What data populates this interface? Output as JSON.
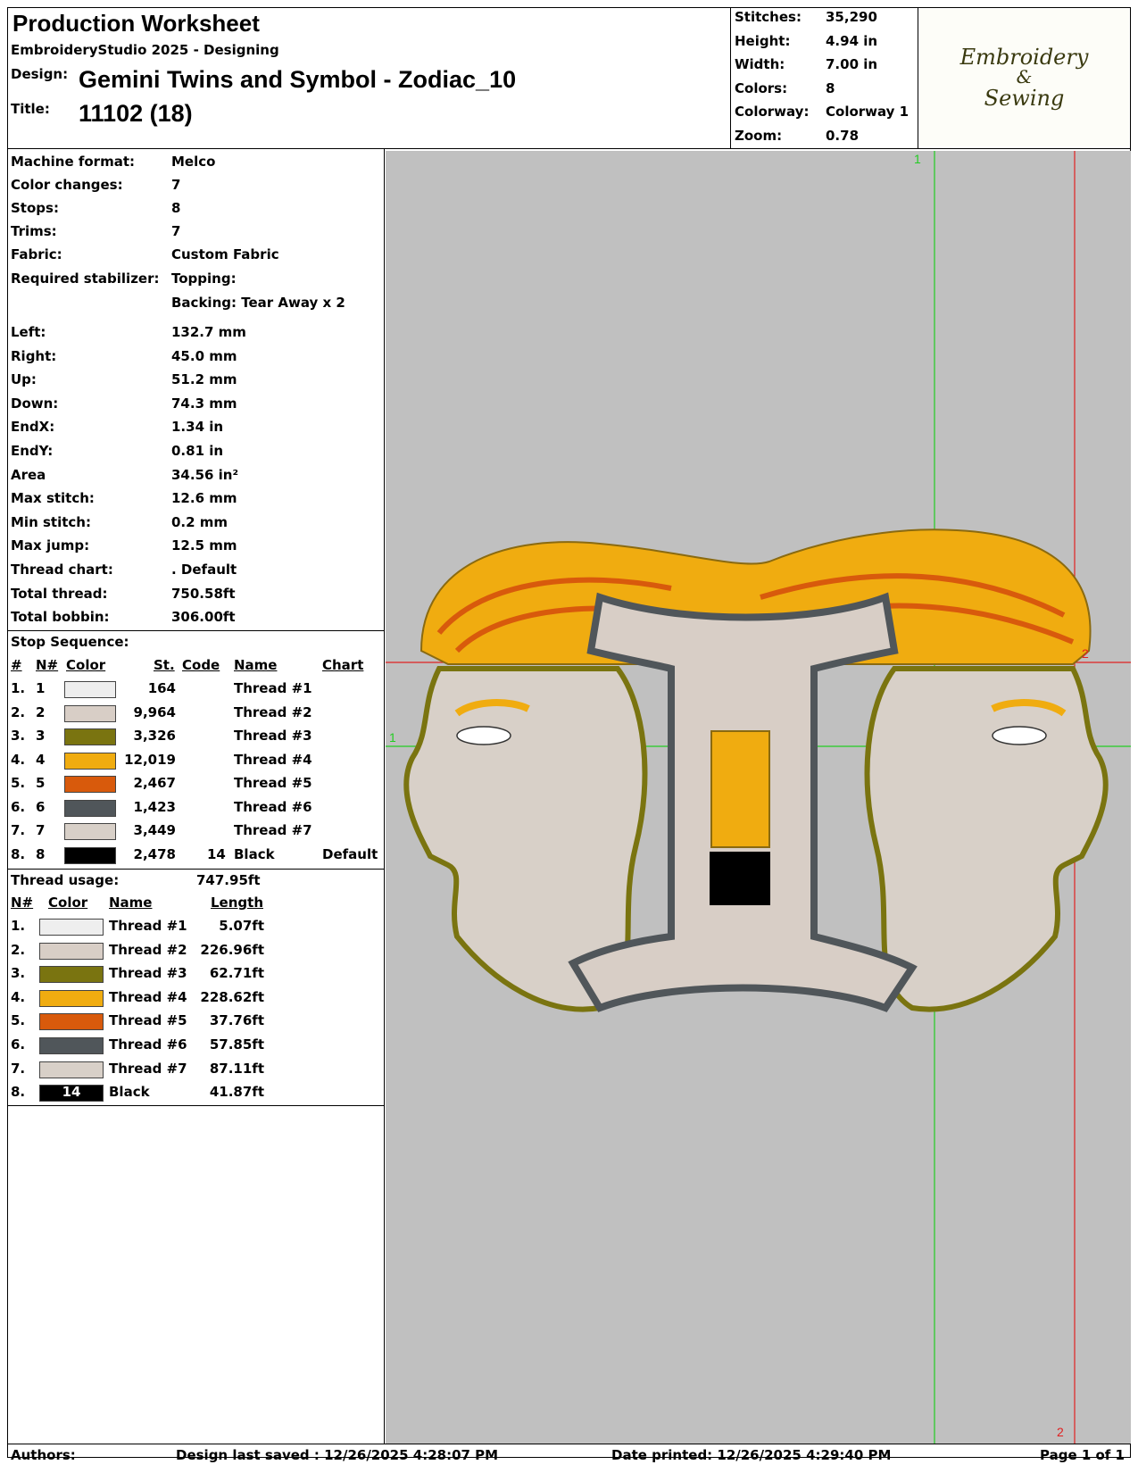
{
  "header": {
    "title": "Production Worksheet",
    "software": "EmbroideryStudio 2025 - Designing",
    "design_label": "Design:",
    "design_value": "Gemini Twins and Symbol - Zodiac_10",
    "title_label": "Title:",
    "title_value": "11102 (18)"
  },
  "stats": {
    "stitches_label": "Stitches:",
    "stitches": "35,290",
    "height_label": "Height:",
    "height": "4.94 in",
    "width_label": "Width:",
    "width": "7.00 in",
    "colors_label": "Colors:",
    "colors": "8",
    "colorway_label": "Colorway:",
    "colorway": "Colorway 1",
    "zoom_label": "Zoom:",
    "zoom": "0.78"
  },
  "logo": {
    "line1": "Embroidery",
    "line2": "&",
    "line3": "Sewing"
  },
  "details": [
    {
      "label": "Machine format:",
      "value": "Melco"
    },
    {
      "label": "Color changes:",
      "value": "7"
    },
    {
      "label": "Stops:",
      "value": "8"
    },
    {
      "label": "Trims:",
      "value": "7"
    },
    {
      "label": "Fabric:",
      "value": "Custom Fabric"
    },
    {
      "label": "Required stabilizer:",
      "value": "Topping:"
    },
    {
      "label": "",
      "value": "Backing: Tear Away x 2"
    }
  ],
  "measures": [
    {
      "label": "Left:",
      "value": "132.7 mm"
    },
    {
      "label": "Right:",
      "value": "45.0 mm"
    },
    {
      "label": "Up:",
      "value": "51.2 mm"
    },
    {
      "label": "Down:",
      "value": "74.3 mm"
    },
    {
      "label": "EndX:",
      "value": "1.34 in"
    },
    {
      "label": "EndY:",
      "value": "0.81 in"
    },
    {
      "label": "Area",
      "value": " 34.56 in²"
    },
    {
      "label": "Max stitch:",
      "value": "12.6 mm"
    },
    {
      "label": "Min stitch:",
      "value": "0.2 mm"
    },
    {
      "label": "Max jump:",
      "value": "12.5 mm"
    },
    {
      "label": "Thread chart:",
      "value": ". Default"
    },
    {
      "label": "Total thread:",
      "value": "750.58ft"
    },
    {
      "label": "Total bobbin:",
      "value": "306.00ft"
    }
  ],
  "stop_sequence": {
    "title": "Stop Sequence:",
    "headers": {
      "num": "#",
      "n": "N#",
      "color": "Color",
      "st": "St.",
      "code": "Code",
      "name": "Name",
      "chart": "Chart"
    },
    "rows": [
      {
        "num": "1.",
        "n": "1",
        "color": "#eeeeee",
        "st": "164",
        "code": "",
        "name": "Thread #1",
        "chart": ""
      },
      {
        "num": "2.",
        "n": "2",
        "color": "#d8cec6",
        "st": "9,964",
        "code": "",
        "name": "Thread #2",
        "chart": ""
      },
      {
        "num": "3.",
        "n": "3",
        "color": "#7a7410",
        "st": "3,326",
        "code": "",
        "name": "Thread #3",
        "chart": ""
      },
      {
        "num": "4.",
        "n": "4",
        "color": "#f0ac10",
        "st": "12,019",
        "code": "",
        "name": "Thread #4",
        "chart": ""
      },
      {
        "num": "5.",
        "n": "5",
        "color": "#d85a0c",
        "st": "2,467",
        "code": "",
        "name": "Thread #5",
        "chart": ""
      },
      {
        "num": "6.",
        "n": "6",
        "color": "#50565a",
        "st": "1,423",
        "code": "",
        "name": "Thread #6",
        "chart": ""
      },
      {
        "num": "7.",
        "n": "7",
        "color": "#d8d0c8",
        "st": "3,449",
        "code": "",
        "name": "Thread #7",
        "chart": ""
      },
      {
        "num": "8.",
        "n": "8",
        "color": "#000000",
        "st": "2,478",
        "code": "14",
        "name": "Black",
        "chart": "Default"
      }
    ]
  },
  "thread_usage": {
    "title": "Thread usage:",
    "total": "747.95ft",
    "headers": {
      "n": "N#",
      "color": "Color",
      "name": "Name",
      "length": "Length"
    },
    "rows": [
      {
        "n": "1.",
        "color": "#eeeeee",
        "code": "",
        "name": "Thread #1",
        "length": "5.07ft"
      },
      {
        "n": "2.",
        "color": "#d8cec6",
        "code": "",
        "name": "Thread #2",
        "length": "226.96ft"
      },
      {
        "n": "3.",
        "color": "#7a7410",
        "code": "",
        "name": "Thread #3",
        "length": "62.71ft"
      },
      {
        "n": "4.",
        "color": "#f0ac10",
        "code": "",
        "name": "Thread #4",
        "length": "228.62ft"
      },
      {
        "n": "5.",
        "color": "#d85a0c",
        "code": "",
        "name": "Thread #5",
        "length": "37.76ft"
      },
      {
        "n": "6.",
        "color": "#50565a",
        "code": "",
        "name": "Thread #6",
        "length": "57.85ft"
      },
      {
        "n": "7.",
        "color": "#d8d0c8",
        "code": "",
        "name": "Thread #7",
        "length": "87.11ft"
      },
      {
        "n": "8.",
        "color": "#000000",
        "code": "14",
        "name": "Black",
        "length": "41.87ft"
      }
    ]
  },
  "canvas": {
    "guide_v1": "1",
    "guide_h1": "1",
    "guide_h2": "2",
    "guide_v2": "2",
    "background": "#c0c0c0"
  },
  "footer": {
    "authors": "Authors:",
    "saved": "Design last saved : 12/26/2025 4:28:07 PM",
    "printed": "Date printed: 12/26/2025 4:29:40 PM",
    "page": "Page 1 of 1"
  }
}
